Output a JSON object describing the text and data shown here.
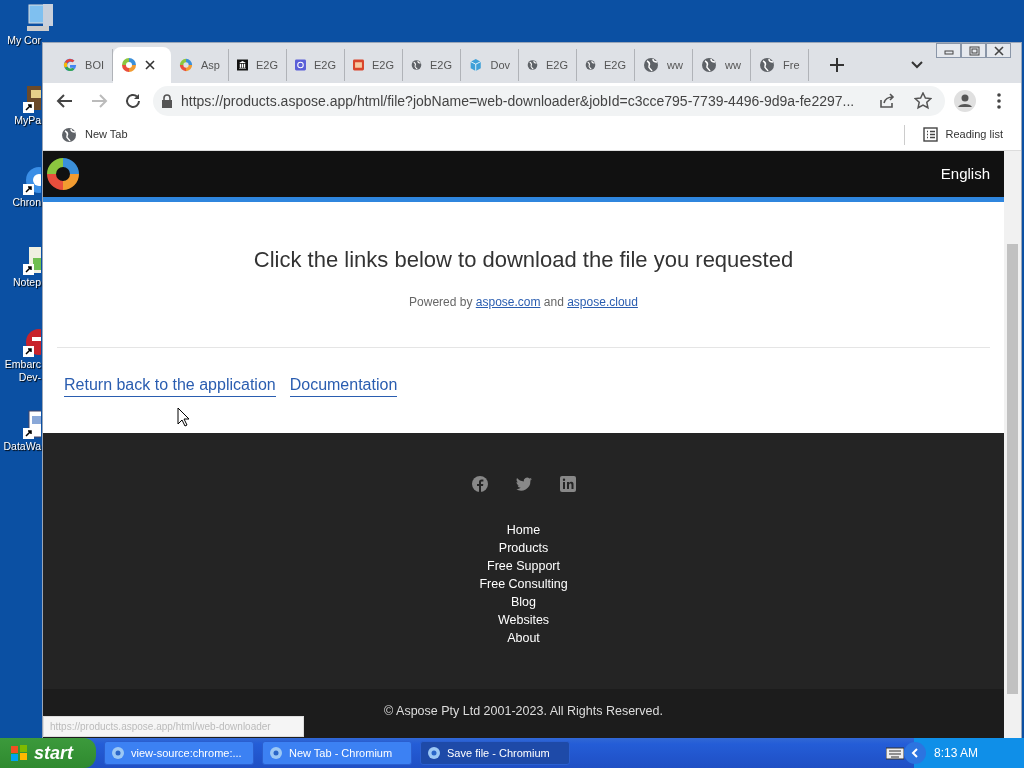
{
  "desktop_icons": [
    {
      "label": "My Cor",
      "kind": "computer"
    },
    {
      "label": "MyPa",
      "kind": "app"
    },
    {
      "label": "Chron",
      "kind": "browser"
    },
    {
      "label": "Notep",
      "kind": "notepad"
    },
    {
      "label": "Embarc\nDev-",
      "kind": "badge"
    },
    {
      "label": "DataWa",
      "kind": "document"
    }
  ],
  "window": {
    "tabs": [
      {
        "title": "BOI",
        "kind": "google",
        "selected": false
      },
      {
        "kind": "swirl",
        "selected": true
      },
      {
        "title": "Asp",
        "kind": "swirl",
        "selected": false
      },
      {
        "title": "E2G",
        "kind": "bank",
        "selected": false
      },
      {
        "title": "E2G",
        "kind": "purple",
        "selected": false
      },
      {
        "title": "E2G",
        "kind": "red",
        "selected": false
      },
      {
        "title": "E2G",
        "kind": "globe",
        "selected": false
      },
      {
        "title": "Dov",
        "kind": "box",
        "selected": false
      },
      {
        "title": "E2G",
        "kind": "globe",
        "selected": false
      },
      {
        "title": "E2G",
        "kind": "globe",
        "selected": false
      },
      {
        "title": "ww",
        "kind": "globe",
        "selected": false
      },
      {
        "title": "ww",
        "kind": "globe",
        "selected": false
      },
      {
        "title": "Fre",
        "kind": "globe",
        "selected": false
      }
    ],
    "address": "https://products.aspose.app/html/file?jobName=web-downloader&jobId=c3cce795-7739-4496-9d9a-fe2297...",
    "bookmarks": [
      "New Tab"
    ],
    "reading_list": "Reading list",
    "status_url": "https://products.aspose.app/html/web-downloader"
  },
  "page": {
    "language": "English",
    "subtitle": "Click the links below to download the file you requested",
    "powered": {
      "prefix": "Powered by",
      "link_1": "aspose.com",
      "middle": "and",
      "link_2": "aspose.cloud"
    },
    "links": [
      "Return back to the application",
      "Documentation"
    ],
    "footer_links": [
      "Home",
      "Products",
      "Free Support",
      "Free Consulting",
      "Blog",
      "Websites",
      "About"
    ],
    "copyright": "© Aspose Pty Ltd 2001-2023. All Rights Reserved."
  },
  "taskbar": {
    "start": "start",
    "tasks": [
      {
        "title": "view-source:chrome:...",
        "selected": false
      },
      {
        "title": "New Tab - Chromium",
        "selected": false
      },
      {
        "title": "Save file - Chromium",
        "selected": true
      }
    ],
    "clock": "8:13 AM"
  }
}
